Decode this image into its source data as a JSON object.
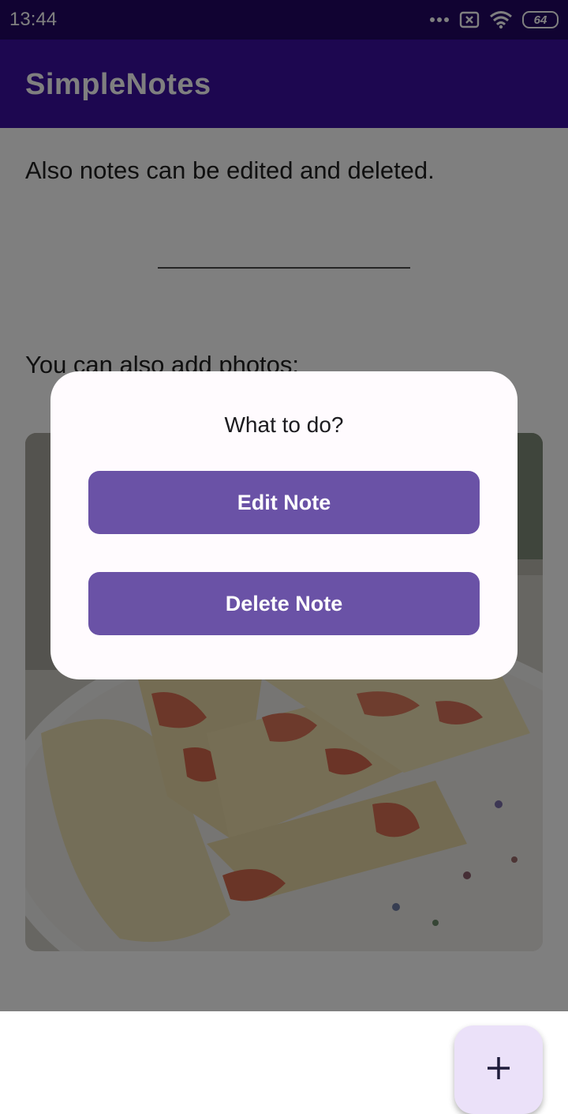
{
  "status_bar": {
    "time": "13:44",
    "icons": [
      "more-dots-icon",
      "sim-card-x-icon",
      "wifi-icon",
      "battery-icon"
    ],
    "battery_level": "64"
  },
  "app_bar": {
    "title": "SimpleNotes"
  },
  "note": {
    "text_1": "Also notes can be edited and deleted.",
    "text_2": "You can also add photos:",
    "photo_icon": "pizza-photo"
  },
  "fab": {
    "icon": "plus-icon"
  },
  "dialog": {
    "title": "What to do?",
    "edit_label": "Edit Note",
    "delete_label": "Delete Note"
  },
  "colors": {
    "status_bar": "#220764",
    "app_bar": "#3b0ea0",
    "dialog_button": "#6a52a6",
    "dialog_bg": "#fffbfe",
    "fab_bg": "#ebe1f9"
  }
}
